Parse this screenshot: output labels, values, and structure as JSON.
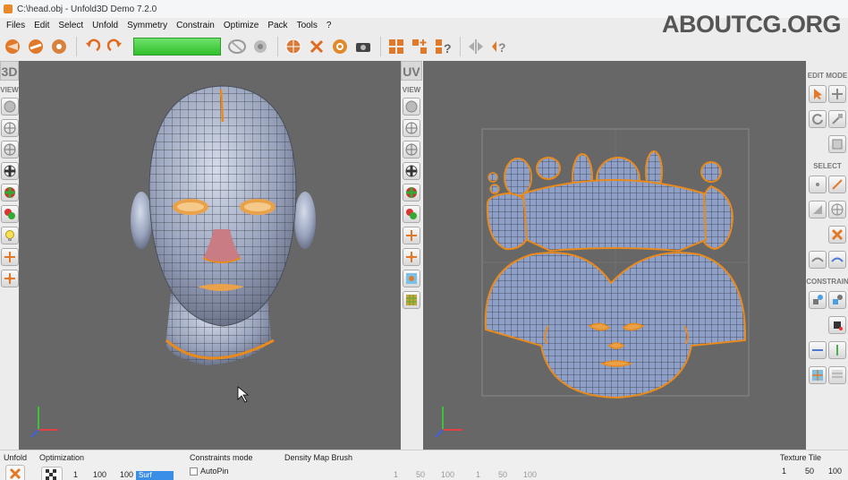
{
  "window": {
    "title": "C:\\head.obj - Unfold3D Demo  7.2.0"
  },
  "watermark": "ABOUTCG.ORG",
  "menu": [
    "Files",
    "Edit",
    "Select",
    "Unfold",
    "Symmetry",
    "Constrain",
    "Optimize",
    "Pack",
    "Tools",
    "?"
  ],
  "viewports": {
    "left_tab": "3D",
    "right_tab": "UV",
    "view_label": "VIEW"
  },
  "right_panel": {
    "edit_mode": "EDIT MODE",
    "select": "SELECT",
    "constrain": "CONSTRAIN"
  },
  "bottom": {
    "unfold": "Unfold",
    "optimization": "Optimization",
    "opt_values": [
      "1",
      "100",
      "100"
    ],
    "opt_mode": "Surf",
    "constraints_mode": "Constraints mode",
    "autopin": "AutoPin",
    "density": "Density Map Brush",
    "density_values": [
      "1",
      "50",
      "100",
      "1",
      "50",
      "100"
    ],
    "texture_tile": "Texture Tile",
    "texture_values": [
      "1",
      "50",
      "100"
    ]
  },
  "colors": {
    "viewport_bg": "#676767",
    "mesh": "#8ea0c8",
    "seam": "#e88a1c",
    "progress": "#2fbf2a"
  }
}
